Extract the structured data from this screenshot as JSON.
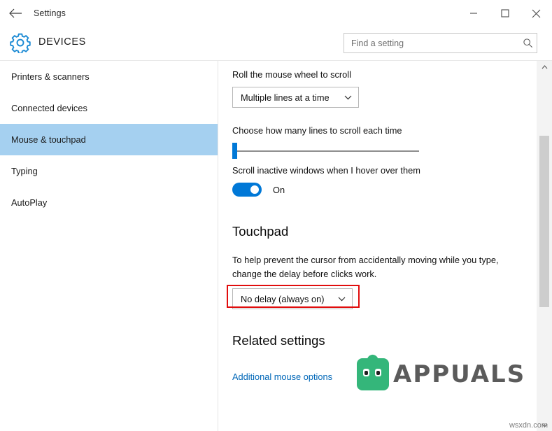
{
  "window": {
    "title": "Settings",
    "back_icon": "back-arrow-icon",
    "minimize_icon": "minimize-icon",
    "maximize_icon": "maximize-icon",
    "close_icon": "close-icon"
  },
  "header": {
    "gear_icon": "gear-icon",
    "page_title": "DEVICES",
    "search_placeholder": "Find a setting",
    "search_value": "",
    "search_icon": "search-icon"
  },
  "sidebar": {
    "items": [
      {
        "label": "Printers & scanners",
        "selected": false
      },
      {
        "label": "Connected devices",
        "selected": false
      },
      {
        "label": "Mouse & touchpad",
        "selected": true
      },
      {
        "label": "Typing",
        "selected": false
      },
      {
        "label": "AutoPlay",
        "selected": false
      }
    ]
  },
  "content": {
    "wheel_label": "Roll the mouse wheel to scroll",
    "wheel_value": "Multiple lines at a time",
    "lines_label": "Choose how many lines to scroll each time",
    "slider_value": "1",
    "inactive_label": "Scroll inactive windows when I hover over them",
    "toggle_state": "On",
    "touchpad_heading": "Touchpad",
    "touchpad_desc": "To help prevent the cursor from accidentally moving while you type, change the delay before clicks work.",
    "delay_value": "No delay (always on)",
    "related_heading": "Related settings",
    "related_link": "Additional mouse options",
    "chevron_icon": "chevron-down-icon"
  },
  "annotations": {
    "highlight_color": "#e10d0d"
  },
  "scrollbar": {
    "up_icon": "chevron-up-icon",
    "down_icon": "chevron-down-icon"
  },
  "watermarks": {
    "brand": "APPUALS",
    "site": "wsxdn.com"
  }
}
